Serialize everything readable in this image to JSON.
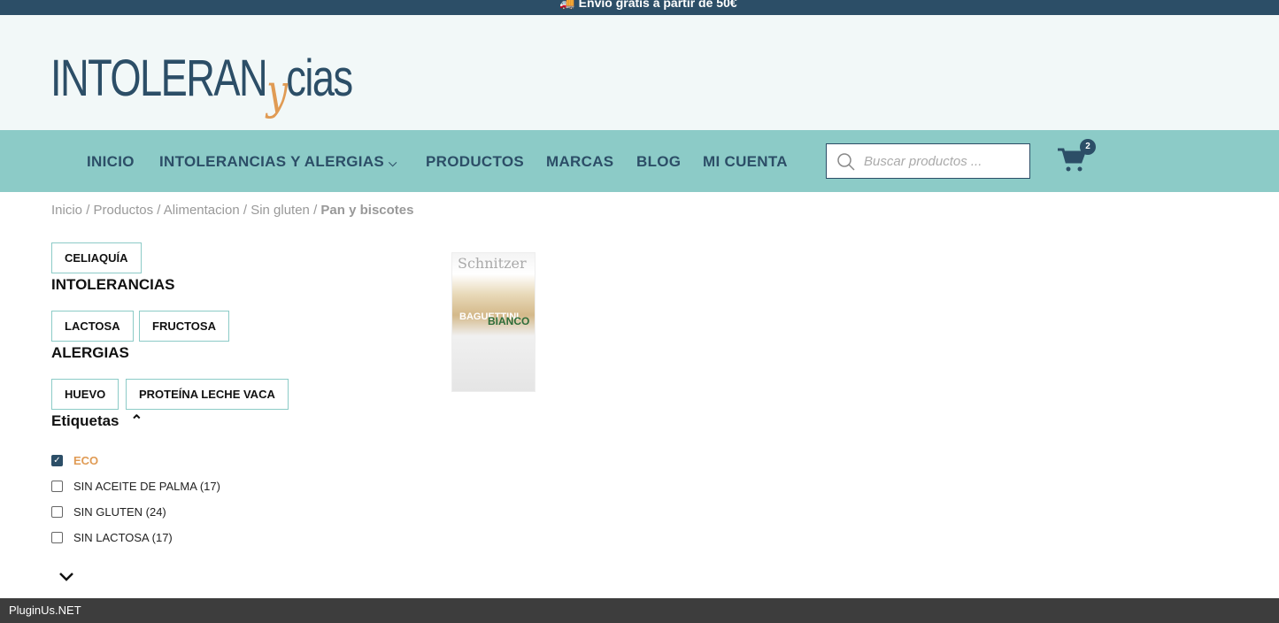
{
  "topbar": {
    "text": "🚚 Envío gratis a partir de 50€"
  },
  "logo": {
    "main": "INTOLERAN",
    "y": "y",
    "end": "cias"
  },
  "nav": {
    "items": [
      "INICIO",
      "INTOLERANCIAS Y ALERGIAS",
      "PRODUCTOS",
      "MARCAS",
      "BLOG",
      "MI CUENTA"
    ],
    "dropdown_icon": "chevron-down-icon"
  },
  "search": {
    "placeholder": "Buscar productos ..."
  },
  "cart": {
    "count": "2"
  },
  "breadcrumb": {
    "items": [
      "Inicio",
      "Productos",
      "Alimentacion",
      "Sin gluten"
    ],
    "current": "Pan y biscotes",
    "sep": "/"
  },
  "filters": {
    "celiaquia": "CELIAQUÍA",
    "intolerancias_title": "INTOLERANCIAS",
    "intolerancias": [
      "LACTOSA",
      "FRUCTOSA"
    ],
    "alergias_title": "ALERGIAS",
    "alergias": [
      "HUEVO",
      "PROTEÍNA LECHE VACA"
    ]
  },
  "tags": {
    "title": "Etiquetas",
    "items": [
      {
        "label": "ECO",
        "count": "",
        "checked": true
      },
      {
        "label": "SIN ACEITE DE PALMA",
        "count": "(17)",
        "checked": false
      },
      {
        "label": "SIN GLUTEN",
        "count": "(24)",
        "checked": false
      },
      {
        "label": "SIN LACTOSA",
        "count": "(17)",
        "checked": false
      }
    ]
  },
  "product": {
    "brand": "Schnitzer",
    "name1": "BAGUETTINI",
    "name2": "BIANCO"
  },
  "footer": {
    "text": "PluginUs.NET"
  }
}
